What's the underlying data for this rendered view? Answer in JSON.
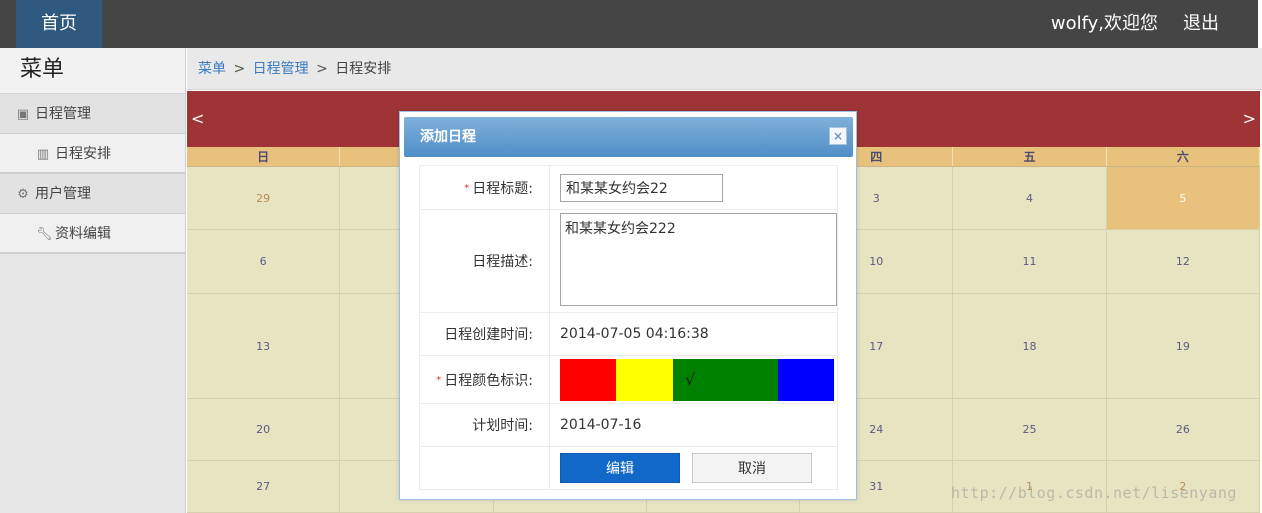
{
  "topbar": {
    "home": "首页",
    "user_greeting": "wolfy,欢迎您",
    "logout": "退出"
  },
  "sidebar": {
    "title": "菜单",
    "groups": [
      {
        "label": "日程管理",
        "icon": "calendar-icon",
        "items": [
          {
            "label": "日程安排",
            "icon": "books-icon"
          }
        ]
      },
      {
        "label": "用户管理",
        "icon": "gear-icon",
        "items": [
          {
            "label": "资料编辑",
            "icon": "wrench-icon"
          }
        ]
      }
    ]
  },
  "breadcrumb": {
    "root": "菜单",
    "section": "日程管理",
    "current": "日程安排",
    "separator": ">"
  },
  "calendar": {
    "prev": "<",
    "next": ">",
    "weekdays": [
      "日",
      "",
      "",
      "",
      "四",
      "五",
      "六"
    ],
    "weeks": [
      [
        "29",
        "",
        "",
        "",
        "3",
        "4",
        "5"
      ],
      [
        "6",
        "",
        "",
        "",
        "10",
        "11",
        "12"
      ],
      [
        "13",
        "",
        "",
        "",
        "17",
        "18",
        "19"
      ],
      [
        "20",
        "",
        "",
        "",
        "24",
        "25",
        "26"
      ],
      [
        "27",
        "",
        "",
        "",
        "31",
        "1",
        "2"
      ]
    ],
    "today": "5",
    "colors": {
      "header": "#9e3435",
      "weekday_bar": "#e8c27d",
      "cell": "#e7e4c1"
    }
  },
  "dialog": {
    "title": "添加日程",
    "close": "×",
    "fields": {
      "title_label": "日程标题:",
      "title_value": "和某某女约会22",
      "desc_label": "日程描述:",
      "desc_value": "和某某女约会222",
      "created_label": "日程创建时间:",
      "created_value": "2014-07-05 04:16:38",
      "color_label": "日程颜色标识:",
      "plan_label": "计划时间:",
      "plan_value": "2014-07-16"
    },
    "required_mark": "*",
    "color_options": [
      {
        "hex": "#ff0000",
        "selected": false,
        "mark": ""
      },
      {
        "hex": "#ffff00",
        "selected": false,
        "mark": ""
      },
      {
        "hex": "#008000",
        "selected": true,
        "mark": "√"
      },
      {
        "hex": "#0000ff",
        "selected": false,
        "mark": ""
      }
    ],
    "buttons": {
      "edit": "编辑",
      "cancel": "取消"
    }
  },
  "watermark": "http://blog.csdn.net/lisenyang"
}
